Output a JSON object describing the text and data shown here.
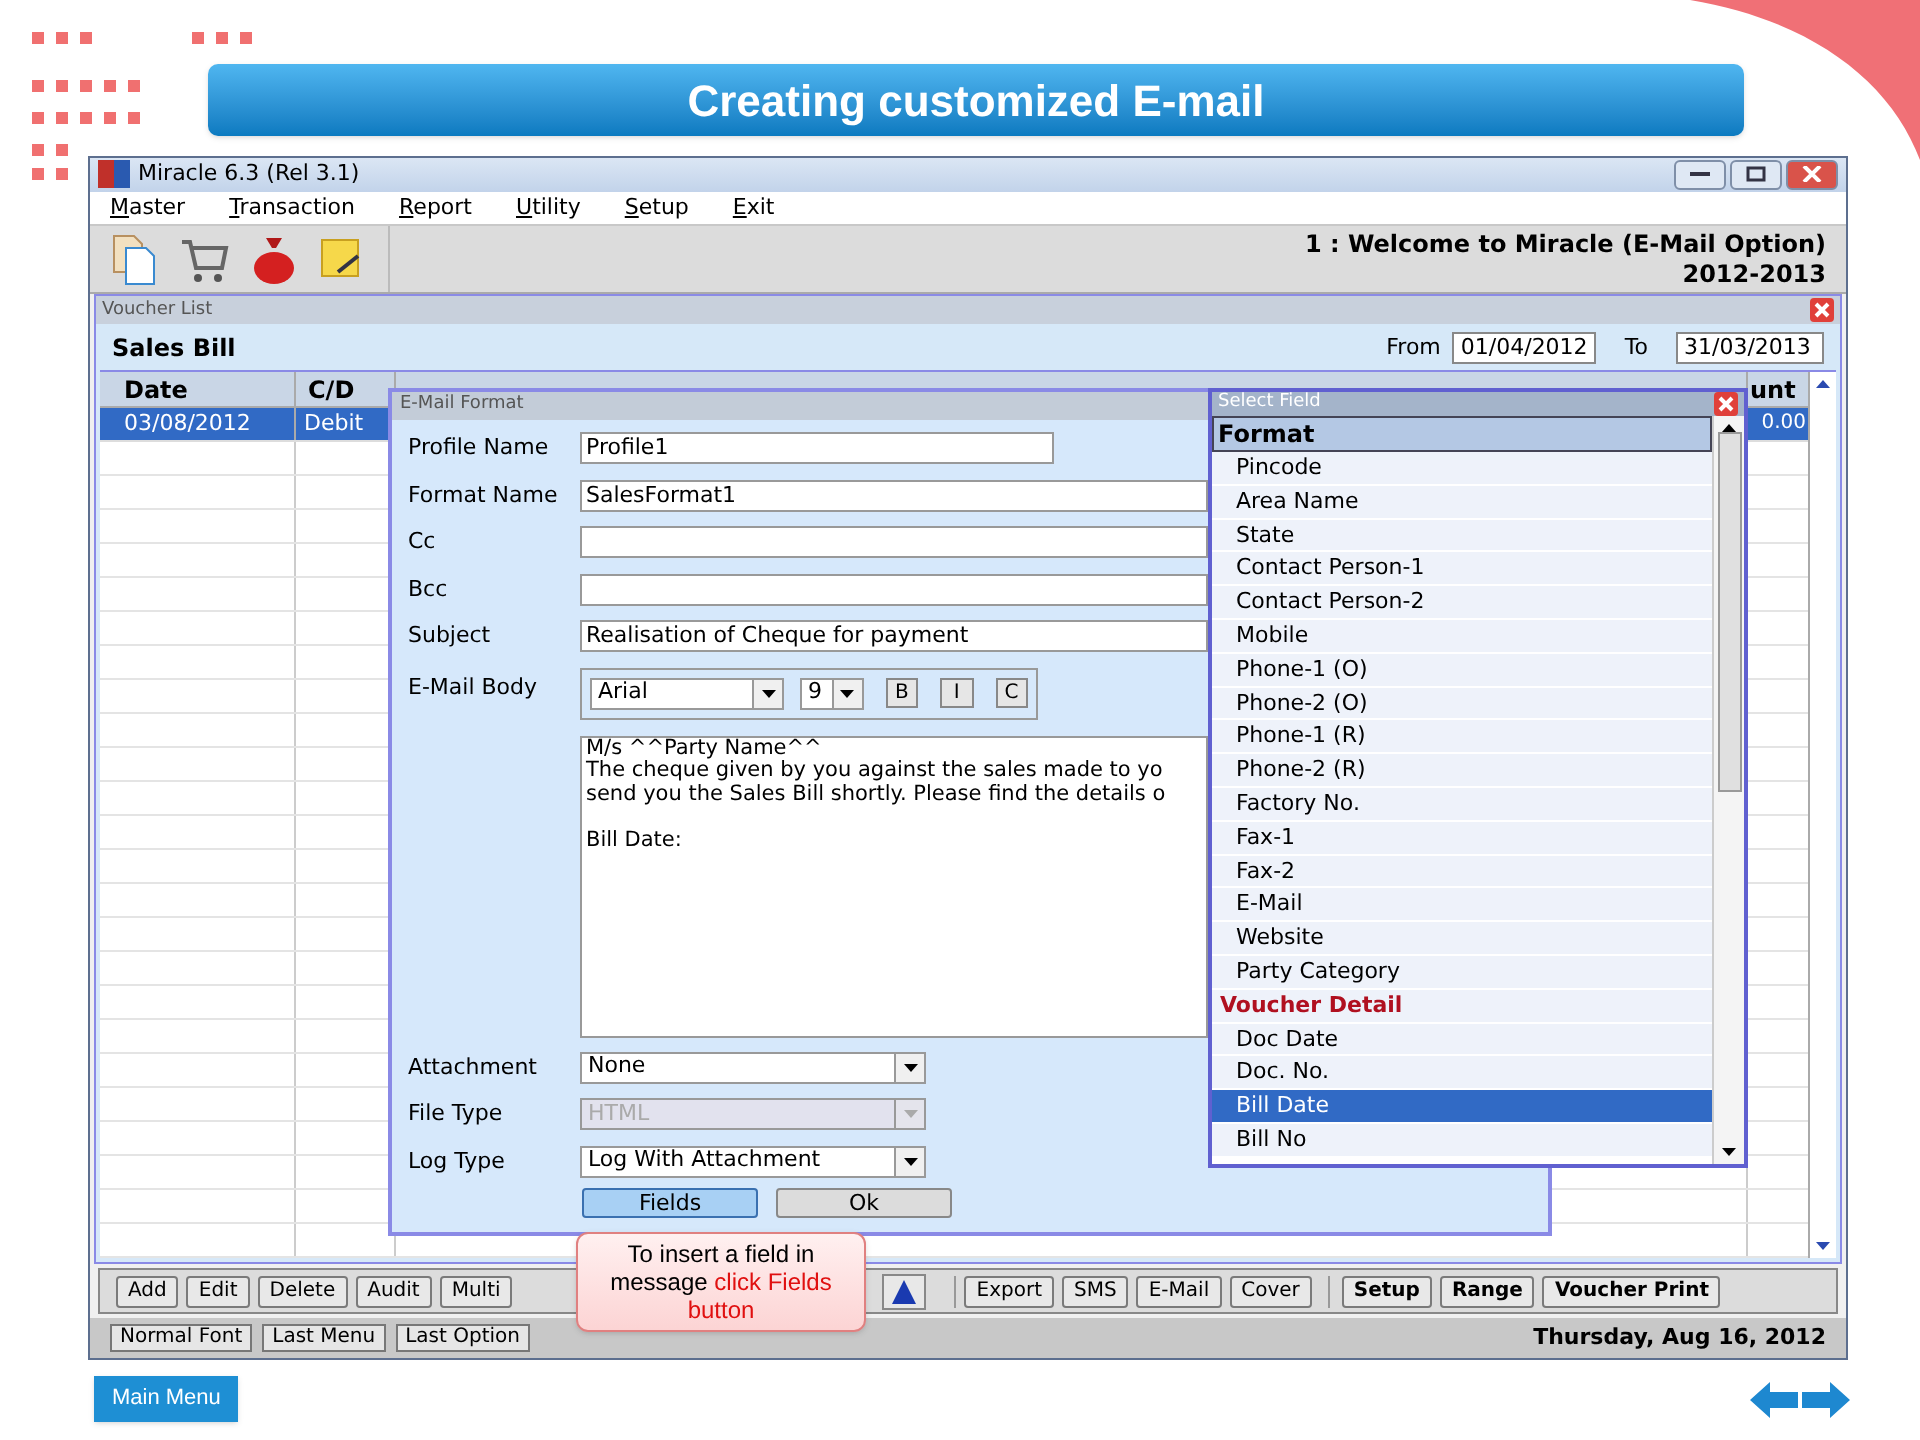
{
  "slide_title": "Creating customized E-mail",
  "window": {
    "title": "Miracle 6.3 (Rel 3.1)"
  },
  "menu": [
    "Master",
    "Transaction",
    "Report",
    "Utility",
    "Setup",
    "Exit"
  ],
  "toolbar": {
    "welcome": "1 : Welcome to Miracle (E-Mail Option)",
    "year": "2012-2013"
  },
  "voucher_list": {
    "title": "Voucher List",
    "heading": "Sales Bill",
    "from_label": "From",
    "from": "01/04/2012",
    "to_label": "To",
    "to": "31/03/2013",
    "columns": [
      "Date",
      "C/D",
      "unt"
    ],
    "rows": [
      {
        "cells": [
          "03/08/2012",
          "Debit",
          "0.00"
        ],
        "selected": true
      }
    ]
  },
  "email_format": {
    "title": "E-Mail Format",
    "fields": [
      {
        "label": "Profile Name",
        "value": "Profile1",
        "kind": "short"
      },
      {
        "label": "Format Name",
        "value": "SalesFormat1",
        "kind": "wide"
      },
      {
        "label": "Cc",
        "kind": "wide"
      },
      {
        "label": "Bcc",
        "kind": "wide"
      },
      {
        "label": "Subject",
        "value": "Realisation of Cheque for payment",
        "kind": "wide"
      }
    ],
    "body_label": "E-Mail Body",
    "font": "Arial",
    "size": "9",
    "style_buttons": [
      "B",
      "I",
      "C"
    ],
    "body_paragraphs": [
      [
        "M/s ^^Party Name^^",
        "The cheque given by you against the sales made to yo",
        "send you the Sales Bill shortly. Please find the details o"
      ],
      [
        "Bill Date:"
      ]
    ],
    "selects": [
      {
        "label": "Attachment",
        "value": "None",
        "disabled": false
      },
      {
        "label": "File Type",
        "value": "HTML",
        "disabled": true
      },
      {
        "label": "Log Type",
        "value": "Log With Attachment",
        "disabled": false
      }
    ],
    "buttons": [
      {
        "label": "Fields",
        "selected": true
      },
      {
        "label": "Ok",
        "selected": false
      }
    ]
  },
  "select_field": {
    "title": "Select Field",
    "header": "Format",
    "items": [
      {
        "label": "Pincode",
        "kind": "field",
        "selected": false
      },
      {
        "label": "Area Name",
        "kind": "field",
        "selected": false
      },
      {
        "label": "State",
        "kind": "field",
        "selected": false
      },
      {
        "label": "Contact Person-1",
        "kind": "field",
        "selected": false
      },
      {
        "label": "Contact Person-2",
        "kind": "field",
        "selected": false
      },
      {
        "label": "Mobile",
        "kind": "field",
        "selected": false
      },
      {
        "label": "Phone-1 (O)",
        "kind": "field",
        "selected": false
      },
      {
        "label": "Phone-2 (O)",
        "kind": "field",
        "selected": false
      },
      {
        "label": "Phone-1 (R)",
        "kind": "field",
        "selected": false
      },
      {
        "label": "Phone-2 (R)",
        "kind": "field",
        "selected": false
      },
      {
        "label": "Factory No.",
        "kind": "field",
        "selected": false
      },
      {
        "label": "Fax-1",
        "kind": "field",
        "selected": false
      },
      {
        "label": "Fax-2",
        "kind": "field",
        "selected": false
      },
      {
        "label": "E-Mail",
        "kind": "field",
        "selected": false
      },
      {
        "label": "Website",
        "kind": "field",
        "selected": false
      },
      {
        "label": "Party Category",
        "kind": "field",
        "selected": false
      },
      {
        "label": "Voucher Detail",
        "kind": "group",
        "selected": false
      },
      {
        "label": "Doc Date",
        "kind": "field",
        "selected": false
      },
      {
        "label": "Doc. No.",
        "kind": "field",
        "selected": false
      },
      {
        "label": "Bill Date",
        "kind": "field",
        "selected": true
      },
      {
        "label": "Bill No",
        "kind": "field",
        "selected": false
      }
    ]
  },
  "action_groups": [
    [
      {
        "label": "Add",
        "bold": false
      },
      {
        "label": "Edit",
        "bold": false
      },
      {
        "label": "Delete",
        "bold": false
      },
      {
        "label": "Audit",
        "bold": false
      },
      {
        "label": "Multi",
        "bold": false
      }
    ],
    [
      {
        "label": "Export",
        "bold": false
      },
      {
        "label": "SMS",
        "bold": false
      },
      {
        "label": "E-Mail",
        "bold": false
      },
      {
        "label": "Cover",
        "bold": false
      }
    ],
    [
      {
        "label": "Setup",
        "bold": true
      },
      {
        "label": "Range",
        "bold": true
      },
      {
        "label": "Voucher Print",
        "bold": true
      }
    ]
  ],
  "status_buttons": [
    "Normal Font",
    "Last Menu",
    "Last Option"
  ],
  "status_date": "Thursday, Aug 16, 2012",
  "callout": {
    "text": "To insert a field in message",
    "highlight": "click Fields button"
  },
  "main_menu": "Main Menu"
}
